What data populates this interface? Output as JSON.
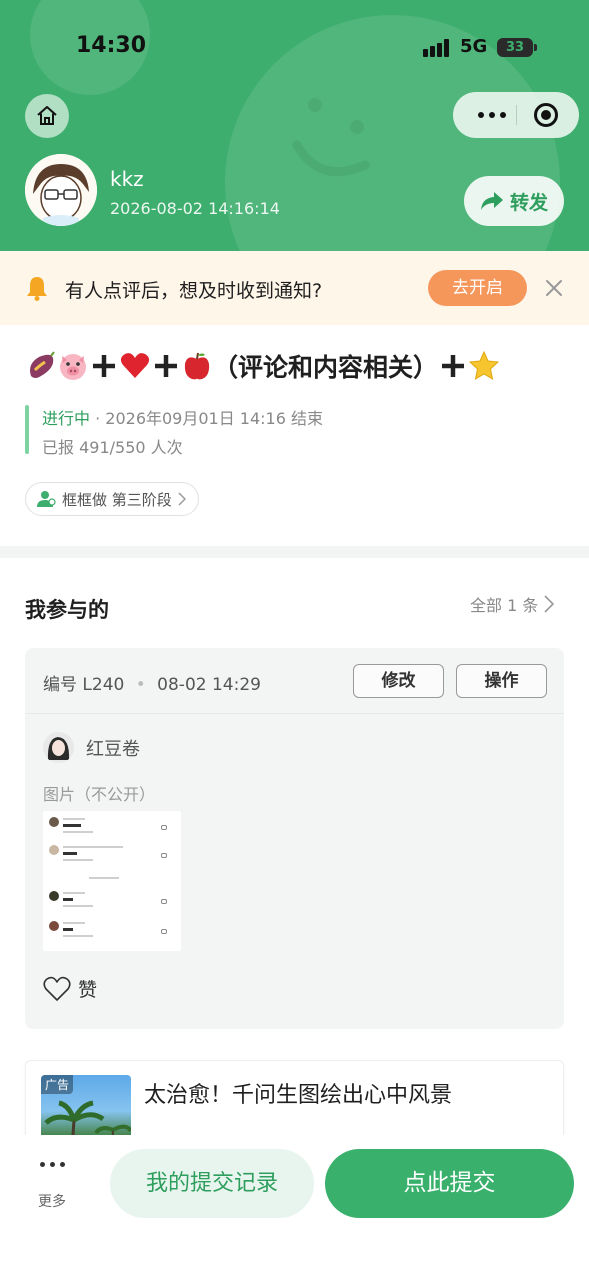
{
  "status_bar": {
    "time": "14:30",
    "network": "5G",
    "battery": "33"
  },
  "header": {
    "username": "kkz",
    "post_time": "2026-08-02 14:16:14",
    "share_label": "转发"
  },
  "notify": {
    "text": "有人点评后，想及时收到通知?",
    "enable_label": "去开启"
  },
  "activity": {
    "title_text": "（评论和内容相关）",
    "title_emojis": [
      "sweet-potato",
      "pig-face",
      "plus",
      "red-heart",
      "plus",
      "red-apple",
      "plus",
      "star"
    ],
    "status": "进行中",
    "end_time": "· 2026年09月01日 14:16 结束",
    "registered": "已报 491/550 人次",
    "stage_chip": "框框做 第三阶段"
  },
  "my_participation": {
    "heading": "我参与的",
    "all_label": "全部 1 条",
    "entry": {
      "id_label": "编号 L240",
      "time": "08-02 14:29",
      "edit_label": "修改",
      "action_label": "操作",
      "participant": "红豆卷",
      "image_label": "图片（不公开）",
      "like_label": "赞"
    }
  },
  "ad": {
    "tag": "广告",
    "title": "太治愈！千问生图绘出心中风景"
  },
  "bottom_bar": {
    "more_label": "更多",
    "records_label": "我的提交记录",
    "submit_label": "点此提交"
  },
  "colors": {
    "brand_green": "#3dae6d",
    "accent_orange": "#f5965b",
    "notify_bg": "#fff6ea"
  }
}
